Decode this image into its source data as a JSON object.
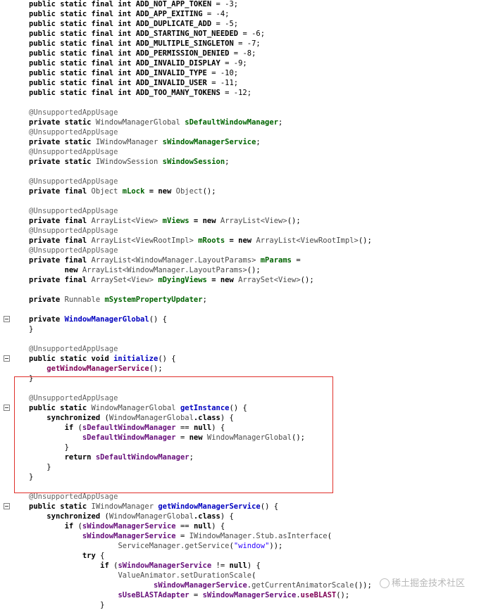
{
  "lines": [
    {
      "segs": [
        [
          "kw",
          "public static final int "
        ],
        [
          "kw",
          "ADD_NOT_APP_TOKEN"
        ],
        [
          "plain",
          " = -3;"
        ]
      ]
    },
    {
      "segs": [
        [
          "kw",
          "public static final int "
        ],
        [
          "kw",
          "ADD_APP_EXITING"
        ],
        [
          "plain",
          " = -4;"
        ]
      ]
    },
    {
      "segs": [
        [
          "kw",
          "public static final int "
        ],
        [
          "kw",
          "ADD_DUPLICATE_ADD"
        ],
        [
          "plain",
          " = -5;"
        ]
      ]
    },
    {
      "segs": [
        [
          "kw",
          "public static final int "
        ],
        [
          "kw",
          "ADD_STARTING_NOT_NEEDED"
        ],
        [
          "plain",
          " = -6;"
        ]
      ]
    },
    {
      "segs": [
        [
          "kw",
          "public static final int "
        ],
        [
          "kw",
          "ADD_MULTIPLE_SINGLETON"
        ],
        [
          "plain",
          " = -7;"
        ]
      ]
    },
    {
      "segs": [
        [
          "kw",
          "public static final int "
        ],
        [
          "kw",
          "ADD_PERMISSION_DENIED"
        ],
        [
          "plain",
          " = -8;"
        ]
      ]
    },
    {
      "segs": [
        [
          "kw",
          "public static final int "
        ],
        [
          "kw",
          "ADD_INVALID_DISPLAY"
        ],
        [
          "plain",
          " = -9;"
        ]
      ]
    },
    {
      "segs": [
        [
          "kw",
          "public static final int "
        ],
        [
          "kw",
          "ADD_INVALID_TYPE"
        ],
        [
          "plain",
          " = -10;"
        ]
      ]
    },
    {
      "segs": [
        [
          "kw",
          "public static final int "
        ],
        [
          "kw",
          "ADD_INVALID_USER"
        ],
        [
          "plain",
          " = -11;"
        ]
      ]
    },
    {
      "segs": [
        [
          "kw",
          "public static final int "
        ],
        [
          "kw",
          "ADD_TOO_MANY_TOKENS"
        ],
        [
          "plain",
          " = -12;"
        ]
      ]
    },
    {
      "segs": []
    },
    {
      "segs": [
        [
          "ann",
          "@UnsupportedAppUsage"
        ]
      ]
    },
    {
      "segs": [
        [
          "kw",
          "private static "
        ],
        [
          "type",
          "WindowManagerGlobal "
        ],
        [
          "green",
          "sDefaultWindowManager"
        ],
        [
          "plain",
          ";"
        ]
      ]
    },
    {
      "segs": [
        [
          "ann",
          "@UnsupportedAppUsage"
        ]
      ]
    },
    {
      "segs": [
        [
          "kw",
          "private static "
        ],
        [
          "type",
          "IWindowManager "
        ],
        [
          "green",
          "sWindowManagerService"
        ],
        [
          "plain",
          ";"
        ]
      ]
    },
    {
      "segs": [
        [
          "ann",
          "@UnsupportedAppUsage"
        ]
      ]
    },
    {
      "segs": [
        [
          "kw",
          "private static "
        ],
        [
          "type",
          "IWindowSession "
        ],
        [
          "green",
          "sWindowSession"
        ],
        [
          "plain",
          ";"
        ]
      ]
    },
    {
      "segs": []
    },
    {
      "segs": [
        [
          "ann",
          "@UnsupportedAppUsage"
        ]
      ]
    },
    {
      "segs": [
        [
          "kw",
          "private final "
        ],
        [
          "type",
          "Object "
        ],
        [
          "green",
          "mLock"
        ],
        [
          "kw",
          " = new "
        ],
        [
          "type",
          "Object"
        ],
        [
          "plain",
          "();"
        ]
      ]
    },
    {
      "segs": []
    },
    {
      "segs": [
        [
          "ann",
          "@UnsupportedAppUsage"
        ]
      ]
    },
    {
      "segs": [
        [
          "kw",
          "private final "
        ],
        [
          "type",
          "ArrayList<View> "
        ],
        [
          "green",
          "mViews"
        ],
        [
          "kw",
          " = new "
        ],
        [
          "type",
          "ArrayList<View>"
        ],
        [
          "plain",
          "();"
        ]
      ]
    },
    {
      "segs": [
        [
          "ann",
          "@UnsupportedAppUsage"
        ]
      ]
    },
    {
      "segs": [
        [
          "kw",
          "private final "
        ],
        [
          "type",
          "ArrayList<ViewRootImpl> "
        ],
        [
          "green",
          "mRoots"
        ],
        [
          "kw",
          " = new "
        ],
        [
          "type",
          "ArrayList<ViewRootImpl>"
        ],
        [
          "plain",
          "();"
        ]
      ]
    },
    {
      "segs": [
        [
          "ann",
          "@UnsupportedAppUsage"
        ]
      ]
    },
    {
      "segs": [
        [
          "kw",
          "private final "
        ],
        [
          "type",
          "ArrayList<WindowManager.LayoutParams> "
        ],
        [
          "green",
          "mParams"
        ],
        [
          "plain",
          " ="
        ]
      ]
    },
    {
      "segs": [
        [
          "plain",
          "        "
        ],
        [
          "kw",
          "new "
        ],
        [
          "type",
          "ArrayList<WindowManager.LayoutParams>"
        ],
        [
          "plain",
          "();"
        ]
      ]
    },
    {
      "segs": [
        [
          "kw",
          "private final "
        ],
        [
          "type",
          "ArraySet<View> "
        ],
        [
          "green",
          "mDyingViews"
        ],
        [
          "kw",
          " = new "
        ],
        [
          "type",
          "ArraySet<View>"
        ],
        [
          "plain",
          "();"
        ]
      ]
    },
    {
      "segs": []
    },
    {
      "segs": [
        [
          "kw",
          "private "
        ],
        [
          "type",
          "Runnable "
        ],
        [
          "green",
          "mSystemPropertyUpdater"
        ],
        [
          "plain",
          ";"
        ]
      ]
    },
    {
      "segs": []
    },
    {
      "segs": [
        [
          "kw",
          "private "
        ],
        [
          "method",
          "WindowManagerGlobal"
        ],
        [
          "plain",
          "() {"
        ]
      ],
      "fold": true
    },
    {
      "segs": [
        [
          "plain",
          "}"
        ]
      ]
    },
    {
      "segs": []
    },
    {
      "segs": [
        [
          "ann",
          "@UnsupportedAppUsage"
        ]
      ]
    },
    {
      "segs": [
        [
          "kw",
          "public static void "
        ],
        [
          "method",
          "initialize"
        ],
        [
          "plain",
          "() {"
        ]
      ],
      "fold": true
    },
    {
      "segs": [
        [
          "plain",
          "    "
        ],
        [
          "fld",
          "getWindowManagerService"
        ],
        [
          "plain",
          "();"
        ]
      ]
    },
    {
      "segs": [
        [
          "plain",
          "}"
        ]
      ]
    },
    {
      "segs": []
    },
    {
      "segs": [
        [
          "ann",
          "@UnsupportedAppUsage"
        ]
      ]
    },
    {
      "segs": [
        [
          "kw",
          "public static "
        ],
        [
          "type",
          "WindowManagerGlobal "
        ],
        [
          "method",
          "getInstance"
        ],
        [
          "plain",
          "() {"
        ]
      ],
      "fold": true
    },
    {
      "segs": [
        [
          "plain",
          "    "
        ],
        [
          "kw",
          "synchronized "
        ],
        [
          "plain",
          "("
        ],
        [
          "type",
          "WindowManagerGlobal"
        ],
        [
          "kw",
          ".class"
        ],
        [
          "plain",
          ") {"
        ]
      ]
    },
    {
      "segs": [
        [
          "plain",
          "        "
        ],
        [
          "kw",
          "if "
        ],
        [
          "plain",
          "("
        ],
        [
          "fld2",
          "sDefaultWindowManager"
        ],
        [
          "plain",
          " == "
        ],
        [
          "kw",
          "null"
        ],
        [
          "plain",
          ") {"
        ]
      ]
    },
    {
      "segs": [
        [
          "plain",
          "            "
        ],
        [
          "fld2",
          "sDefaultWindowManager"
        ],
        [
          "plain",
          " = "
        ],
        [
          "kw",
          "new "
        ],
        [
          "type",
          "WindowManagerGlobal"
        ],
        [
          "plain",
          "();"
        ]
      ]
    },
    {
      "segs": [
        [
          "plain",
          "        }"
        ]
      ]
    },
    {
      "segs": [
        [
          "plain",
          "        "
        ],
        [
          "kw",
          "return "
        ],
        [
          "fld2",
          "sDefaultWindowManager"
        ],
        [
          "plain",
          ";"
        ]
      ]
    },
    {
      "segs": [
        [
          "plain",
          "    }"
        ]
      ]
    },
    {
      "segs": [
        [
          "plain",
          "}"
        ]
      ]
    },
    {
      "segs": []
    },
    {
      "segs": [
        [
          "ann",
          "@UnsupportedAppUsage"
        ]
      ]
    },
    {
      "segs": [
        [
          "kw",
          "public static "
        ],
        [
          "type",
          "IWindowManager "
        ],
        [
          "method",
          "getWindowManagerService"
        ],
        [
          "plain",
          "() {"
        ]
      ],
      "fold": true
    },
    {
      "segs": [
        [
          "plain",
          "    "
        ],
        [
          "kw",
          "synchronized "
        ],
        [
          "plain",
          "("
        ],
        [
          "type",
          "WindowManagerGlobal"
        ],
        [
          "kw",
          ".class"
        ],
        [
          "plain",
          ") {"
        ]
      ]
    },
    {
      "segs": [
        [
          "plain",
          "        "
        ],
        [
          "kw",
          "if "
        ],
        [
          "plain",
          "("
        ],
        [
          "fld2",
          "sWindowManagerService"
        ],
        [
          "plain",
          " == "
        ],
        [
          "kw",
          "null"
        ],
        [
          "plain",
          ") {"
        ]
      ]
    },
    {
      "segs": [
        [
          "plain",
          "            "
        ],
        [
          "fld2",
          "sWindowManagerService"
        ],
        [
          "plain",
          " = "
        ],
        [
          "type",
          "IWindowManager.Stub.asInterface"
        ],
        [
          "plain",
          "("
        ]
      ]
    },
    {
      "segs": [
        [
          "plain",
          "                    "
        ],
        [
          "type",
          "ServiceManager.getService"
        ],
        [
          "plain",
          "("
        ],
        [
          "str",
          "\"window\""
        ],
        [
          "plain",
          "));"
        ]
      ]
    },
    {
      "segs": [
        [
          "plain",
          "            "
        ],
        [
          "kw",
          "try "
        ],
        [
          "plain",
          "{"
        ]
      ]
    },
    {
      "segs": [
        [
          "plain",
          "                "
        ],
        [
          "kw",
          "if "
        ],
        [
          "plain",
          "("
        ],
        [
          "fld2",
          "sWindowManagerService"
        ],
        [
          "plain",
          " != "
        ],
        [
          "kw",
          "null"
        ],
        [
          "plain",
          ") {"
        ]
      ]
    },
    {
      "segs": [
        [
          "plain",
          "                    "
        ],
        [
          "type",
          "ValueAnimator.setDurationScale"
        ],
        [
          "plain",
          "("
        ]
      ]
    },
    {
      "segs": [
        [
          "plain",
          "                            "
        ],
        [
          "fld2",
          "sWindowManagerService"
        ],
        [
          "plain",
          "."
        ],
        [
          "type",
          "getCurrentAnimatorScale"
        ],
        [
          "plain",
          "());"
        ]
      ]
    },
    {
      "segs": [
        [
          "plain",
          "                    "
        ],
        [
          "fld2",
          "sUseBLASTAdapter"
        ],
        [
          "plain",
          " = "
        ],
        [
          "fld2",
          "sWindowManagerService"
        ],
        [
          "plain",
          "."
        ],
        [
          "fld",
          "useBLAST"
        ],
        [
          "plain",
          "();"
        ]
      ]
    },
    {
      "segs": [
        [
          "plain",
          "                }"
        ]
      ]
    }
  ],
  "watermark": "稀土掘金技术社区"
}
